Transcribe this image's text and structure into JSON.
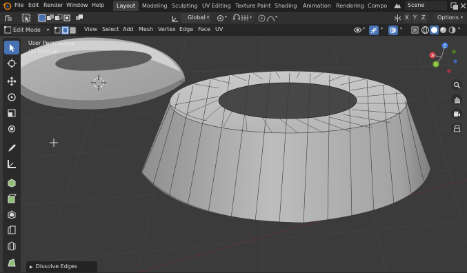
{
  "menu": {
    "file": "File",
    "edit": "Edit",
    "render": "Render",
    "window": "Window",
    "help": "Help"
  },
  "workspaces": [
    {
      "label": "Layout",
      "active": true
    },
    {
      "label": "Modeling"
    },
    {
      "label": "Sculpting"
    },
    {
      "label": "UV Editing"
    },
    {
      "label": "Texture Paint"
    },
    {
      "label": "Shading"
    },
    {
      "label": "Animation"
    },
    {
      "label": "Rendering"
    },
    {
      "label": "Compo"
    }
  ],
  "scene": {
    "label": "Scene"
  },
  "toolbar": {
    "transform_orientation": "Global",
    "options": "Options",
    "axis_x": "X",
    "axis_y": "Y",
    "axis_z": "Z"
  },
  "header3": {
    "mode": "Edit Mode",
    "view": "View",
    "select": "Select",
    "add": "Add",
    "mesh": "Mesh",
    "vertex": "Vertex",
    "edge": "Edge",
    "face": "Face",
    "uv": "UV"
  },
  "viewport": {
    "perspective": "User Perspective",
    "object": "(1) Manual"
  },
  "operator_panel": {
    "label": "Dissolve Edges"
  },
  "gizmo": {
    "x": "X",
    "y": "Y",
    "z": "Z"
  },
  "colors": {
    "accent": "#4772b3",
    "active_tab": "#3d3d3d",
    "axis_x": "#e0424f",
    "axis_y": "#7dbb2a",
    "axis_z": "#3c7be0"
  }
}
